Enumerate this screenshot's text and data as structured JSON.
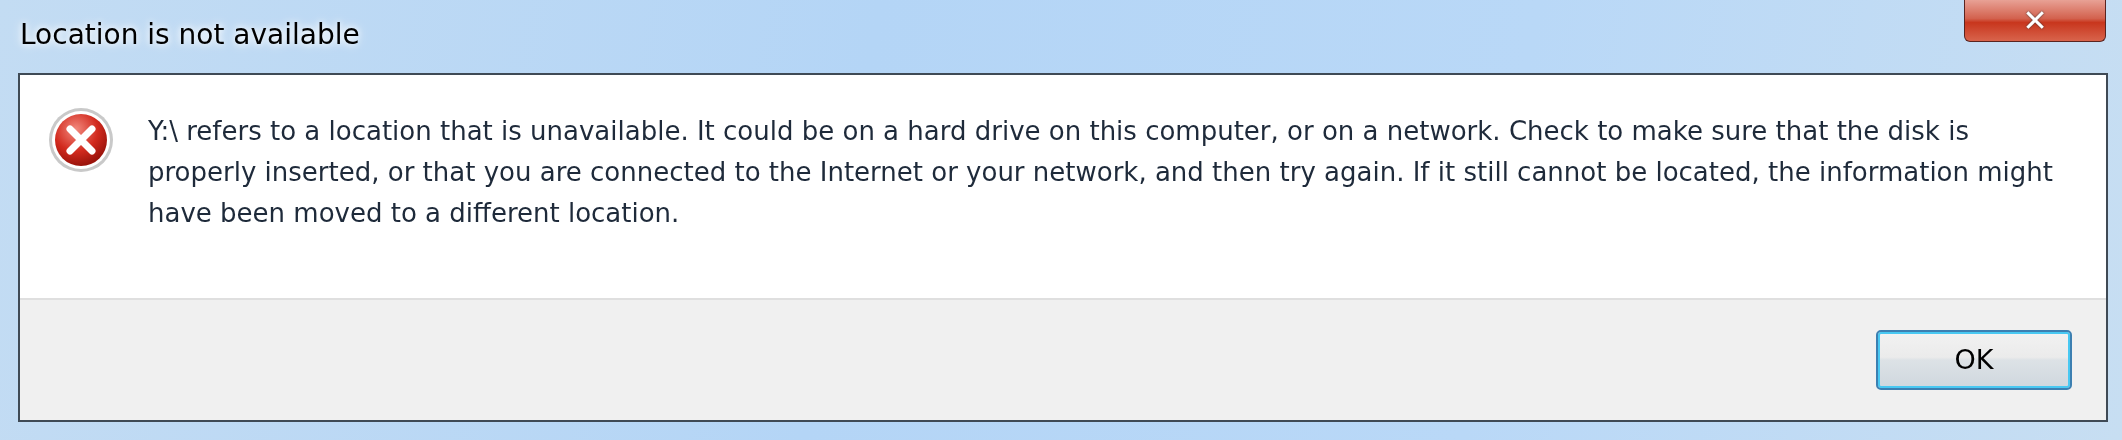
{
  "window": {
    "title": "Location is not available",
    "close": "✕"
  },
  "message": "Y:\\ refers to a location that is unavailable. It could be on a hard drive on this computer, or on a network. Check to make sure that the disk is properly inserted, or that you are connected to the Internet or your network, and then try again. If it still cannot be located, the information might have been moved to a different location.",
  "buttons": [
    {
      "label": "OK",
      "selected": true
    }
  ]
}
